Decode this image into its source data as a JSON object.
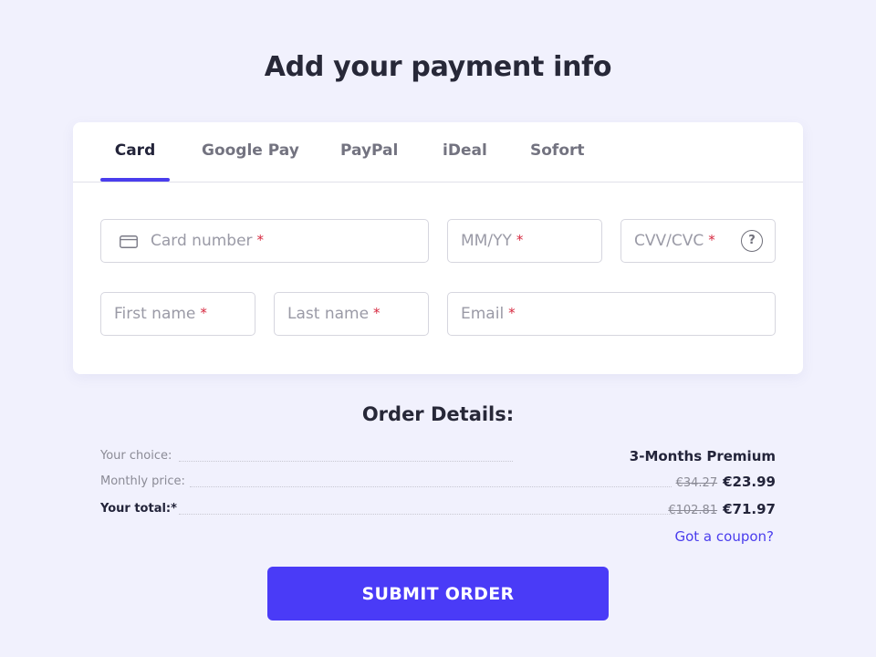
{
  "page": {
    "title": "Add your payment info"
  },
  "tabs": [
    {
      "label": "Card",
      "active": true
    },
    {
      "label": "Google Pay",
      "active": false
    },
    {
      "label": "PayPal",
      "active": false
    },
    {
      "label": "iDeal",
      "active": false
    },
    {
      "label": "Sofort",
      "active": false
    }
  ],
  "form": {
    "card_number": {
      "placeholder": "Card number",
      "required_mark": "*",
      "value": ""
    },
    "expiry": {
      "placeholder": "MM/YY",
      "required_mark": "*",
      "value": ""
    },
    "cvv": {
      "placeholder": "CVV/CVC",
      "required_mark": "*",
      "value": "",
      "help_glyph": "?"
    },
    "first_name": {
      "placeholder": "First name",
      "required_mark": "*",
      "value": ""
    },
    "last_name": {
      "placeholder": "Last name",
      "required_mark": "*",
      "value": ""
    },
    "email": {
      "placeholder": "Email",
      "required_mark": "*",
      "value": ""
    }
  },
  "order": {
    "title": "Order Details:",
    "choice": {
      "label": "Your choice:",
      "value": "3-Months Premium"
    },
    "monthly": {
      "label": "Monthly price:",
      "old_price": "€34.27",
      "price": "€23.99"
    },
    "total": {
      "label": "Your total:*",
      "old_price": "€102.81",
      "price": "€71.97"
    },
    "coupon_link": "Got a coupon?"
  },
  "submit_label": "SUBMIT ORDER",
  "colors": {
    "accent": "#4a3ded",
    "button": "#4a3bf7",
    "background": "#f1f1fd",
    "required": "#d6283f"
  },
  "icons": {
    "card_field": "credit-card-icon",
    "cvv_field": "question-circle-icon"
  }
}
